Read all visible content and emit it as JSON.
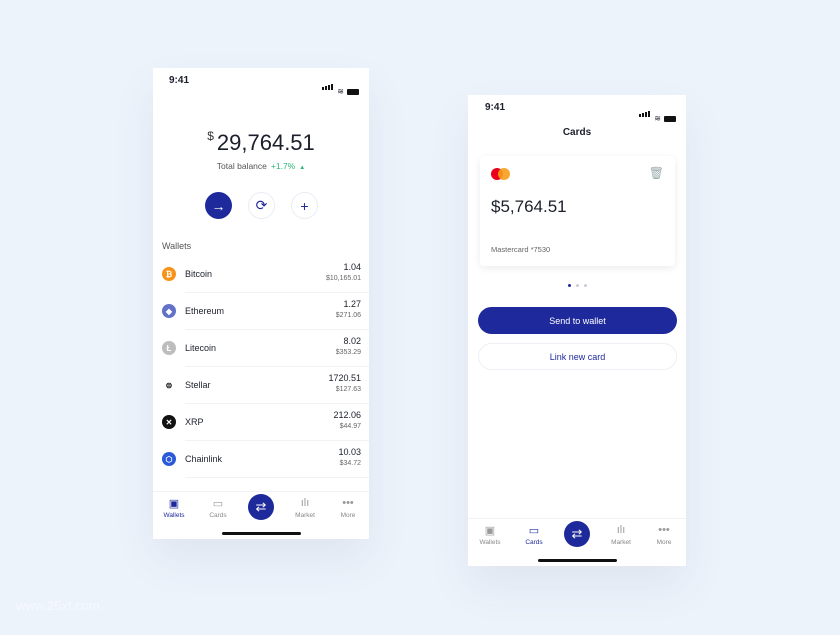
{
  "status": {
    "time": "9:41"
  },
  "wallets_screen": {
    "balance_currency": "$",
    "balance": "29,764.51",
    "total_label": "Total balance",
    "change": "+1.7%",
    "actions": [
      {
        "icon": "arrow-right-icon",
        "glyph": "→"
      },
      {
        "icon": "refresh-icon",
        "glyph": "⟳"
      },
      {
        "icon": "plus-icon",
        "glyph": "+"
      }
    ],
    "section_label": "Wallets",
    "wallets": [
      {
        "name": "Bitcoin",
        "amount": "1.04",
        "usd": "$10,165.01",
        "color": "#f7931a",
        "glyph": "₿"
      },
      {
        "name": "Ethereum",
        "amount": "1.27",
        "usd": "$271.06",
        "color": "#6272c9",
        "glyph": "◆"
      },
      {
        "name": "Litecoin",
        "amount": "8.02",
        "usd": "$353.29",
        "color": "#bdbdbd",
        "glyph": "Ł"
      },
      {
        "name": "Stellar",
        "amount": "1720.51",
        "usd": "$127.63",
        "color": "#ffffff",
        "glyph": "⊜"
      },
      {
        "name": "XRP",
        "amount": "212.06",
        "usd": "$44.97",
        "color": "#111111",
        "glyph": "✕"
      },
      {
        "name": "Chainlink",
        "amount": "10.03",
        "usd": "$34.72",
        "color": "#2a5ada",
        "glyph": "⬡"
      }
    ]
  },
  "tabs": [
    {
      "label": "Wallets",
      "glyph": "▣"
    },
    {
      "label": "Cards",
      "glyph": "▭"
    },
    {
      "label": "Market",
      "glyph": "ılı"
    },
    {
      "label": "More",
      "glyph": "•••"
    }
  ],
  "center_glyph": "⇄",
  "cards_screen": {
    "title": "Cards",
    "card_balance": "$5,764.51",
    "card_name": "Mastercard *7530",
    "send_label": "Send to wallet",
    "link_label": "Link new card"
  },
  "colors": {
    "accent": "#1e2a9c",
    "positive": "#2bb673"
  },
  "watermark": "www.25xt.com"
}
